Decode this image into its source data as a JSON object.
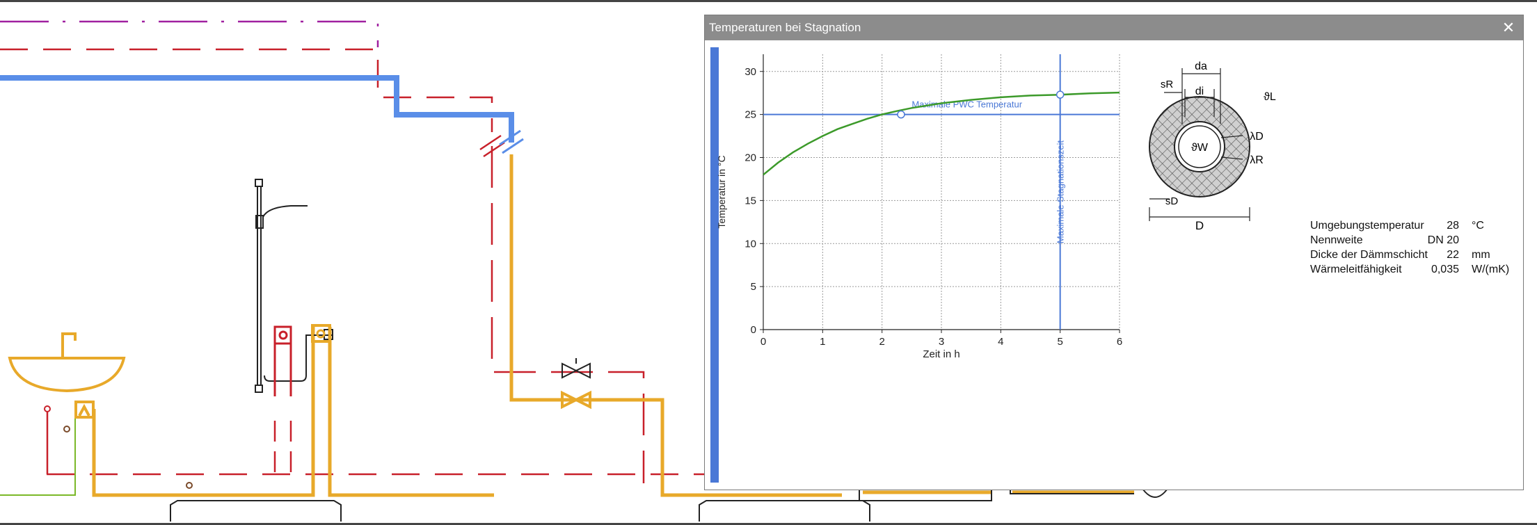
{
  "window": {
    "title": "Temperaturen bei Stagnation",
    "close_glyph": "✕"
  },
  "colors": {
    "pipe_hot": "#e8a92a",
    "pipe_cold": "#5a8ee8",
    "pipe_circulation": "#c8202a",
    "pipe_purple": "#a020a0",
    "pipe_green": "#7ab828",
    "curve": "#3c9a2a",
    "reference_line": "#4a78d6",
    "side_bar": "#4a78d6",
    "titlebar": "#8c8c8c"
  },
  "chart_data": {
    "type": "line",
    "title": "",
    "xlabel": "Zeit in h",
    "ylabel": "Temperatur in °C",
    "xlim": [
      0,
      6
    ],
    "ylim": [
      0,
      32
    ],
    "x_ticks": [
      0,
      1,
      2,
      3,
      4,
      5,
      6
    ],
    "y_ticks": [
      0,
      5,
      10,
      15,
      20,
      25,
      30
    ],
    "grid": true,
    "series": [
      {
        "x": [
          0,
          0.25,
          0.5,
          0.75,
          1,
          1.25,
          1.5,
          1.75,
          2,
          2.25,
          2.5,
          3,
          3.5,
          4,
          4.5,
          5,
          5.5,
          6
        ],
        "y": [
          18.0,
          19.4,
          20.6,
          21.6,
          22.5,
          23.3,
          23.9,
          24.5,
          25.0,
          25.4,
          25.75,
          26.3,
          26.7,
          27.0,
          27.2,
          27.3,
          27.45,
          27.55
        ]
      }
    ],
    "reference_lines": [
      {
        "orientation": "horizontal",
        "value": 25,
        "label": "Maximale PWC Temperatur"
      },
      {
        "orientation": "vertical",
        "value": 5,
        "label": "Maximale Stagnationszeit"
      }
    ],
    "markers": [
      {
        "x": 2.32,
        "y": 25.0
      },
      {
        "x": 5.0,
        "y": 27.3
      }
    ]
  },
  "diagram": {
    "labels": {
      "d_a": "da",
      "d_i": "di",
      "s_r": "sR",
      "s_d": "sD",
      "theta_l": "ϑL",
      "theta_w": "ϑW",
      "lambda_d": "λD",
      "lambda_r": "λR",
      "d_outer": "D"
    }
  },
  "properties": [
    {
      "label": "Umgebungstemperatur",
      "value": "28",
      "unit": "°C"
    },
    {
      "label": "Nennweite",
      "value": "DN 20",
      "unit": ""
    },
    {
      "label": "Dicke der Dämmschicht",
      "value": "22",
      "unit": "mm"
    },
    {
      "label": "Wärmeleitfähigkeit",
      "value": "0,035",
      "unit": "W/(mK)"
    }
  ]
}
